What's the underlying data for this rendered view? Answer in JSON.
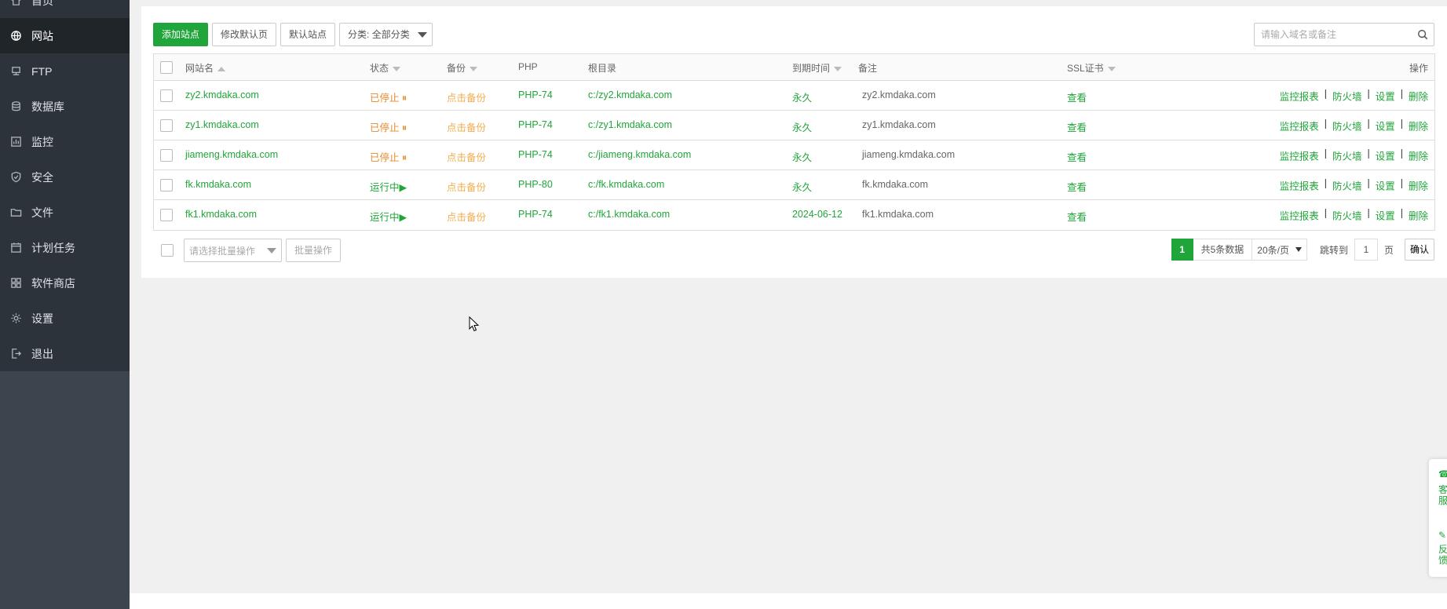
{
  "sidebar": {
    "items": [
      {
        "label": "首页",
        "icon": "home-icon"
      },
      {
        "label": "网站",
        "icon": "globe-icon",
        "active": true
      },
      {
        "label": "FTP",
        "icon": "ftp-icon"
      },
      {
        "label": "数据库",
        "icon": "database-icon"
      },
      {
        "label": "监控",
        "icon": "monitor-icon"
      },
      {
        "label": "安全",
        "icon": "shield-icon"
      },
      {
        "label": "文件",
        "icon": "folder-icon"
      },
      {
        "label": "计划任务",
        "icon": "calendar-icon"
      },
      {
        "label": "软件商店",
        "icon": "apps-icon"
      },
      {
        "label": "设置",
        "icon": "gear-icon"
      },
      {
        "label": "退出",
        "icon": "logout-icon"
      }
    ]
  },
  "toolbar": {
    "add_site": "添加站点",
    "edit_default_page": "修改默认页",
    "default_site": "默认站点",
    "category": "分类: 全部分类"
  },
  "search": {
    "placeholder": "请输入域名或备注"
  },
  "table": {
    "headers": {
      "name": "网站名",
      "status": "状态",
      "backup": "备份",
      "php": "PHP",
      "root": "根目录",
      "expire": "到期时间",
      "remark": "备注",
      "ssl": "SSL证书",
      "actions": "操作"
    },
    "rows": [
      {
        "name": "zy2.kmdaka.com",
        "status": "已停止",
        "backup": "点击备份",
        "php": "PHP-74",
        "root": "c:/zy2.kmdaka.com",
        "expire": "永久",
        "remark": "zy2.kmdaka.com",
        "ssl": "查看"
      },
      {
        "name": "zy1.kmdaka.com",
        "status": "已停止",
        "backup": "点击备份",
        "php": "PHP-74",
        "root": "c:/zy1.kmdaka.com",
        "expire": "永久",
        "remark": "zy1.kmdaka.com",
        "ssl": "查看"
      },
      {
        "name": "jiameng.kmdaka.com",
        "status": "已停止",
        "backup": "点击备份",
        "php": "PHP-74",
        "root": "c:/jiameng.kmdaka.com",
        "expire": "永久",
        "remark": "jiameng.kmdaka.com",
        "ssl": "查看"
      },
      {
        "name": "fk.kmdaka.com",
        "status": "运行中",
        "backup": "点击备份",
        "php": "PHP-80",
        "root": "c:/fk.kmdaka.com",
        "expire": "永久",
        "remark": "fk.kmdaka.com",
        "ssl": "查看"
      },
      {
        "name": "fk1.kmdaka.com",
        "status": "运行中",
        "backup": "点击备份",
        "php": "PHP-74",
        "root": "c:/fk1.kmdaka.com",
        "expire": "2024-06-12",
        "remark": "fk1.kmdaka.com",
        "ssl": "查看"
      }
    ],
    "actions": {
      "report": "监控报表",
      "firewall": "防火墙",
      "settings": "设置",
      "delete": "删除",
      "separator": "|"
    }
  },
  "footer": {
    "batch_placeholder": "请选择批量操作",
    "batch_button": "批量操作",
    "current_page": "1",
    "total": "共5条数据",
    "per_page": "20条/页",
    "goto_label": "跳转到",
    "goto_value": "1",
    "page_unit": "页",
    "confirm": "确认"
  },
  "float_widget": {
    "service": "客服",
    "feedback": "反馈"
  },
  "colors": {
    "accent": "#20a53a",
    "stopped": "#e6892a",
    "backup": "#f0ad4e",
    "sidebar_bg": "#3c444d"
  }
}
